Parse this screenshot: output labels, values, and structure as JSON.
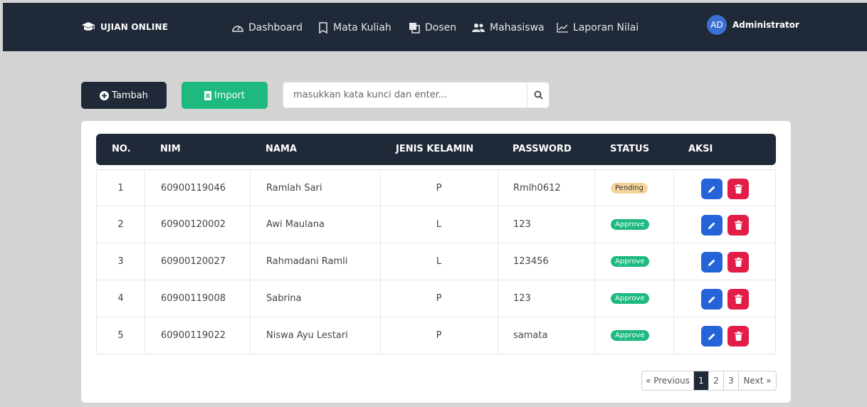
{
  "app": {
    "brand": "UJIAN ONLINE"
  },
  "nav": [
    {
      "label": "Dashboard",
      "icon": "gauge-icon"
    },
    {
      "label": "Mata Kuliah",
      "icon": "book-icon"
    },
    {
      "label": "Dosen",
      "icon": "copy-icon"
    },
    {
      "label": "Mahasiswa",
      "icon": "users-icon"
    },
    {
      "label": "Laporan Nilai",
      "icon": "chart-line-icon"
    }
  ],
  "user": {
    "initials": "AD",
    "name": "Administrator"
  },
  "toolbar": {
    "add_label": "Tambah",
    "import_label": "Import"
  },
  "search": {
    "placeholder": "masukkan kata kunci dan enter..."
  },
  "table": {
    "headers": [
      "NO.",
      "NIM",
      "NAMA",
      "JENIS KELAMIN",
      "PASSWORD",
      "STATUS",
      "AKSI"
    ],
    "rows": [
      {
        "no": "1",
        "nim": "60900119046",
        "nama": "Ramlah Sari",
        "jk": "P",
        "password": "Rmlh0612",
        "status": "Pending"
      },
      {
        "no": "2",
        "nim": "60900120002",
        "nama": "Awi Maulana",
        "jk": "L",
        "password": "123",
        "status": "Approve"
      },
      {
        "no": "3",
        "nim": "60900120027",
        "nama": "Rahmadani Ramli",
        "jk": "L",
        "password": "123456",
        "status": "Approve"
      },
      {
        "no": "4",
        "nim": "60900119008",
        "nama": "Sabrina",
        "jk": "P",
        "password": "123",
        "status": "Approve"
      },
      {
        "no": "5",
        "nim": "60900119022",
        "nama": "Niswa Ayu Lestari",
        "jk": "P",
        "password": "samata",
        "status": "Approve"
      }
    ]
  },
  "pagination": {
    "previous": "« Previous",
    "pages": [
      "1",
      "2",
      "3"
    ],
    "next": "Next »",
    "current": "1"
  },
  "colors": {
    "navbar": "#1f2937",
    "import": "#1db97f",
    "edit": "#2563d8",
    "delete": "#e11d48",
    "pending": "#f5d49a",
    "approve": "#1db97f"
  }
}
